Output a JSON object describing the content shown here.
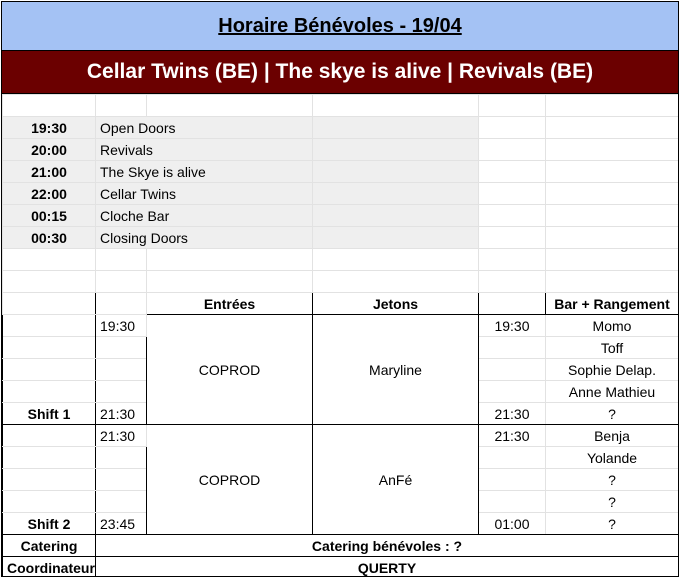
{
  "header": {
    "title": "Horaire Bénévoles - 19/04",
    "lineup": "Cellar Twins (BE) | The skye is alive | Revivals (BE)"
  },
  "schedule": [
    {
      "time": "19:30",
      "event": "Open Doors"
    },
    {
      "time": "20:00",
      "event": "Revivals"
    },
    {
      "time": "21:00",
      "event": "The Skye is alive"
    },
    {
      "time": "22:00",
      "event": "Cellar Twins"
    },
    {
      "time": "00:15",
      "event": "Cloche Bar"
    },
    {
      "time": "00:30",
      "event": "Closing Doors"
    }
  ],
  "columns": {
    "entrees": "Entrées",
    "jetons": "Jetons",
    "bar": "Bar + Rangement"
  },
  "shift1": {
    "label": "Shift 1",
    "start": "19:30",
    "end": "21:30",
    "entrees": "COPROD",
    "jetons": "Maryline",
    "bar_start": "19:30",
    "bar_end": "21:30",
    "bar_people": [
      "Momo",
      "Toff",
      "Sophie Delap.",
      "Anne Mathieu",
      "?"
    ]
  },
  "shift2": {
    "label": "Shift 2",
    "start": "21:30",
    "end": "23:45",
    "entrees": "COPROD",
    "jetons": "AnFé",
    "bar_start": "21:30",
    "bar_end": "01:00",
    "bar_people": [
      "Benja",
      "Yolande",
      "?",
      "?",
      "?"
    ]
  },
  "catering": {
    "label": "Catering",
    "value": "Catering bénévoles : ?"
  },
  "coordinateur": {
    "label": "Coordinateur",
    "value": "QUERTY"
  }
}
